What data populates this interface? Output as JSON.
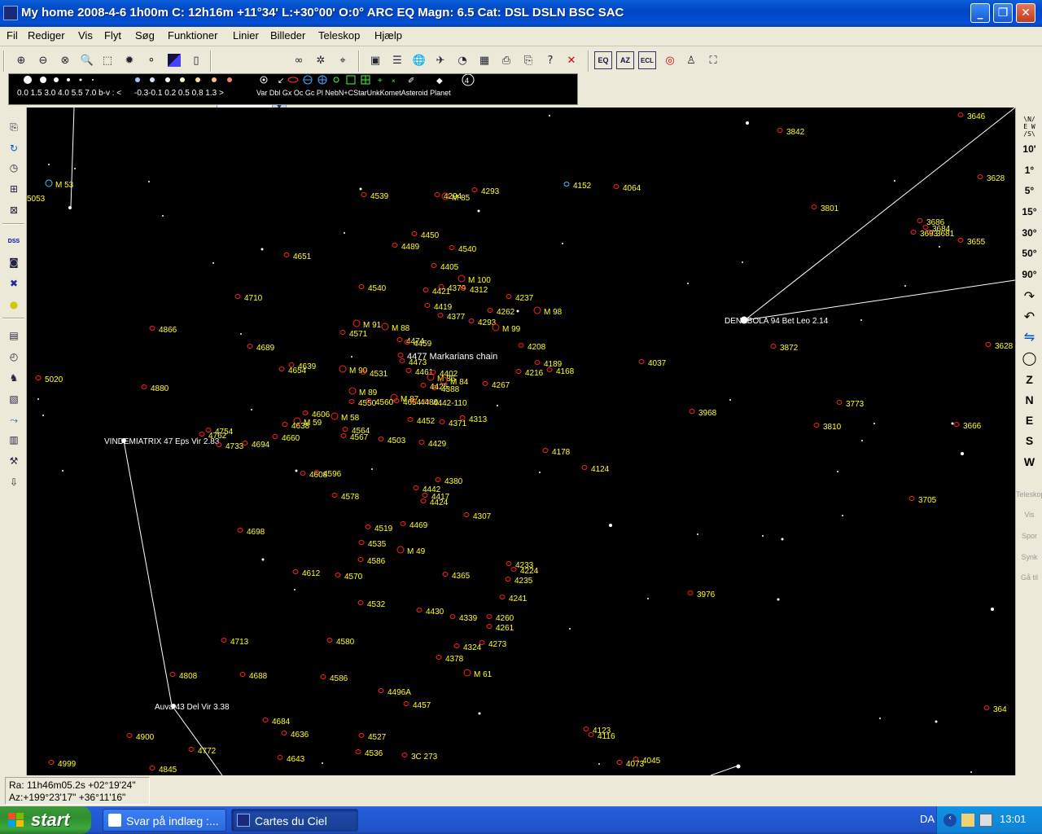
{
  "window": {
    "title": "My home 2008-4-6   1h00m C: 12h16m +11°34' L:+30°00' O:0° ARC EQ Magn: 6.5 Cat: DSL DSLN BSC SAC",
    "minimize_icon": "minimize-icon",
    "maximize_icon": "restore-icon",
    "close_icon": "close-icon"
  },
  "menu": [
    "Fil",
    "Rediger",
    "Vis",
    "Flyt",
    "Søg",
    "Funktioner",
    "Linier",
    "Billeder",
    "Teleskop",
    "Hjælp"
  ],
  "toolbar": {
    "icons": [
      "zoom-in-icon",
      "zoom-out-icon",
      "zoom-fit-icon",
      "search-icon",
      "select-area-icon",
      "star-icon",
      "planet-icon",
      "color-invert-icon",
      "page-icon"
    ],
    "fov_value": "",
    "icons2": [
      "binoculars-icon",
      "telescope-find-icon",
      "telescope-icon",
      "save-icon",
      "list-icon",
      "globe-icon",
      "satellite-icon",
      "gauge-icon",
      "calendar-icon",
      "print-icon",
      "print-setup-icon",
      "help-icon",
      "exit-icon"
    ],
    "projection_buttons": [
      "EQ",
      "AZ",
      "ECL"
    ],
    "icons3": [
      "target-icon",
      "person-icon",
      "frame-icon"
    ]
  },
  "legend": {
    "magnitudes": "0.0 1.5 3.0 4.0 5.5 7.0 b-v : <",
    "colors": "-0.3-0.1 0.2 0.5 0.8 1.3 >",
    "types": "Var Dbl  Gx  Oc  Gc  Pl  NebN+CStarUnkKometAsteroid Planet"
  },
  "left_toolbar": [
    "copy-icon",
    "rotate-icon",
    "clock-icon",
    "grid-icon",
    "grid2-icon",
    "dss-icon",
    "camera-icon",
    "cross-icon",
    "bulb-icon",
    "catalog-icon",
    "compass-icon",
    "figure-icon",
    "image-icon",
    "line-icon",
    "print-chart-icon",
    "export-icon"
  ],
  "right_toolbar": {
    "direction_glyph": "NESW-icon",
    "fov_buttons": [
      "10'",
      "1°",
      "5°",
      "15°",
      "30°",
      "50°",
      "90°"
    ],
    "rotation_icons": [
      "rotate-right-icon",
      "rotate-left-icon",
      "flip-icon",
      "circle-icon"
    ],
    "directions": [
      "Z",
      "N",
      "E",
      "S",
      "W"
    ],
    "disabled": [
      "Teleskop",
      "Vis",
      "Spor",
      "Synk",
      "Gå til"
    ]
  },
  "status": {
    "ra": "Ra: 11h46m05.2s +02°19'24\"",
    "az": "Az:+199°23'17\" +36°11'16\""
  },
  "taskbar": {
    "start": "start",
    "tasks": [
      "Svar på indlæg :...",
      "Cartes du Ciel"
    ],
    "language": "DA",
    "clock": "13:01"
  },
  "chart_data": {
    "type": "scatter",
    "objects_yellow": [
      [
        "3646",
        1188,
        142
      ],
      [
        "3842",
        966,
        161
      ],
      [
        "M 53",
        68,
        226
      ],
      [
        "5053",
        33,
        243
      ],
      [
        "4539",
        455,
        240
      ],
      [
        "4294",
        545,
        240
      ],
      [
        "M 85",
        555,
        242
      ],
      [
        "4293",
        591,
        234
      ],
      [
        "4152",
        704,
        227
      ],
      [
        "4064",
        765,
        230
      ],
      [
        "3801",
        1008,
        255
      ],
      [
        "3628",
        1212,
        218
      ],
      [
        "3686",
        1138,
        272
      ],
      [
        "3684",
        1145,
        280
      ],
      [
        "3681",
        1150,
        286
      ],
      [
        "3693",
        1130,
        286
      ],
      [
        "3655",
        1188,
        296
      ],
      [
        "4450",
        517,
        288
      ],
      [
        "4489",
        493,
        302
      ],
      [
        "4540",
        563,
        305
      ],
      [
        "4651",
        360,
        314
      ],
      [
        "4405",
        541,
        327
      ],
      [
        "M 100",
        575,
        343
      ],
      [
        "4379",
        550,
        353
      ],
      [
        "4312",
        577,
        355
      ],
      [
        "4421",
        531,
        357
      ],
      [
        "4540",
        452,
        353
      ],
      [
        "4710",
        300,
        365
      ],
      [
        "4237",
        633,
        365
      ],
      [
        "4419",
        533,
        376
      ],
      [
        "4262",
        610,
        382
      ],
      [
        "M 98",
        668,
        382
      ],
      [
        "4377",
        549,
        388
      ],
      [
        "4293",
        587,
        395
      ],
      [
        "M 91",
        446,
        398
      ],
      [
        "M 88",
        481,
        402
      ],
      [
        "M 99",
        617,
        403
      ],
      [
        "4571",
        429,
        409
      ],
      [
        "4866",
        195,
        404
      ],
      [
        "4474",
        499,
        418
      ],
      [
        "4459",
        508,
        421
      ],
      [
        "4208",
        648,
        425
      ],
      [
        "4689",
        315,
        426
      ],
      [
        "3872",
        958,
        426
      ],
      [
        "3628",
        1222,
        424
      ],
      [
        "4477 Markarians chain",
        500,
        437
      ],
      [
        "4473",
        502,
        444
      ],
      [
        "4639",
        366,
        449
      ],
      [
        "4189",
        668,
        446
      ],
      [
        "4037",
        796,
        445
      ],
      [
        "4654",
        354,
        454
      ],
      [
        "4461",
        510,
        456
      ],
      [
        "4402",
        540,
        458
      ],
      [
        "M 90",
        429,
        454
      ],
      [
        "4531",
        454,
        458
      ],
      [
        "4216",
        645,
        457
      ],
      [
        "4168",
        683,
        455
      ],
      [
        "M 86",
        537,
        464
      ],
      [
        "M 84",
        553,
        468
      ],
      [
        "4388",
        542,
        477
      ],
      [
        "4267",
        604,
        472
      ],
      [
        "4425",
        528,
        474
      ],
      [
        "5020",
        55,
        465
      ],
      [
        "4880",
        185,
        476
      ],
      [
        "M 89",
        441,
        481
      ],
      [
        "M 87",
        492,
        489
      ],
      [
        "4442-110",
        532,
        494
      ],
      [
        "4550",
        440,
        494
      ],
      [
        "4560",
        461,
        493
      ],
      [
        "4654",
        495,
        493
      ],
      [
        "4480",
        516,
        493
      ],
      [
        "3968",
        858,
        506
      ],
      [
        "3773",
        1039,
        495
      ],
      [
        "4606",
        383,
        508
      ],
      [
        "M 58",
        419,
        512
      ],
      [
        "4452",
        512,
        516
      ],
      [
        "4371",
        551,
        519
      ],
      [
        "4313",
        576,
        514
      ],
      [
        "M 59",
        373,
        518
      ],
      [
        "4638",
        358,
        522
      ],
      [
        "3810",
        1011,
        523
      ],
      [
        "3666",
        1183,
        522
      ],
      [
        "4754",
        264,
        529
      ],
      [
        "4762",
        256,
        534
      ],
      [
        "4564",
        432,
        528
      ],
      [
        "4567",
        430,
        536
      ],
      [
        "4660",
        346,
        537
      ],
      [
        "4503",
        476,
        540
      ],
      [
        "4429",
        526,
        544
      ],
      [
        "VINDEMIATRIX 47 Eps Vir 2.83",
        128,
        541
      ],
      [
        "4733",
        277,
        547
      ],
      [
        "4694",
        309,
        545
      ],
      [
        "4178",
        678,
        554
      ],
      [
        "4124",
        726,
        575
      ],
      [
        "4596",
        397,
        581
      ],
      [
        "4608",
        380,
        582
      ],
      [
        "4380",
        546,
        590
      ],
      [
        "4442",
        519,
        600
      ],
      [
        "4417",
        530,
        609
      ],
      [
        "4578",
        419,
        609
      ],
      [
        "4424",
        528,
        616
      ],
      [
        "3705",
        1128,
        613
      ],
      [
        "4307",
        581,
        633
      ],
      [
        "4469",
        503,
        644
      ],
      [
        "4519",
        460,
        648
      ],
      [
        "4698",
        303,
        652
      ],
      [
        "4535",
        452,
        667
      ],
      [
        "M 49",
        500,
        676
      ],
      [
        "4586",
        451,
        688
      ],
      [
        "4233",
        633,
        693
      ],
      [
        "4224",
        639,
        700
      ],
      [
        "4612",
        371,
        703
      ],
      [
        "4570",
        423,
        707
      ],
      [
        "4365",
        555,
        706
      ],
      [
        "4235",
        632,
        712
      ],
      [
        "3976",
        856,
        729
      ],
      [
        "4241",
        625,
        734
      ],
      [
        "4532",
        451,
        741
      ],
      [
        "4430",
        523,
        750
      ],
      [
        "4339",
        564,
        758
      ],
      [
        "4260",
        609,
        758
      ],
      [
        "4261",
        609,
        770
      ],
      [
        "4713",
        283,
        787
      ],
      [
        "4580",
        413,
        787
      ],
      [
        "4273",
        600,
        790
      ],
      [
        "4324",
        569,
        794
      ],
      [
        "4378",
        547,
        808
      ],
      [
        "M 61",
        582,
        827
      ],
      [
        "4808",
        220,
        829
      ],
      [
        "4688",
        306,
        829
      ],
      [
        "4586",
        405,
        832
      ],
      [
        "4496A",
        476,
        849
      ],
      [
        "4457",
        507,
        865
      ],
      [
        "Auva 43 Del Vir 3.38",
        190,
        867
      ],
      [
        "4636",
        357,
        901
      ],
      [
        "4123",
        728,
        896
      ],
      [
        "4116",
        734,
        903
      ],
      [
        "4900",
        167,
        904
      ],
      [
        "4527",
        452,
        904
      ],
      [
        "4772",
        243,
        921
      ],
      [
        "4536",
        448,
        924
      ],
      [
        "3C 273",
        505,
        928
      ],
      [
        "4643",
        352,
        931
      ],
      [
        "4045",
        789,
        933
      ],
      [
        "4073",
        769,
        937
      ],
      [
        "4999",
        71,
        937
      ],
      [
        "4845",
        195,
        944
      ],
      [
        "DENEBOLA 94 Bet Leo 2.14",
        890,
        393
      ],
      [
        "4684",
        334,
        885
      ],
      [
        "364",
        1220,
        870
      ]
    ]
  }
}
